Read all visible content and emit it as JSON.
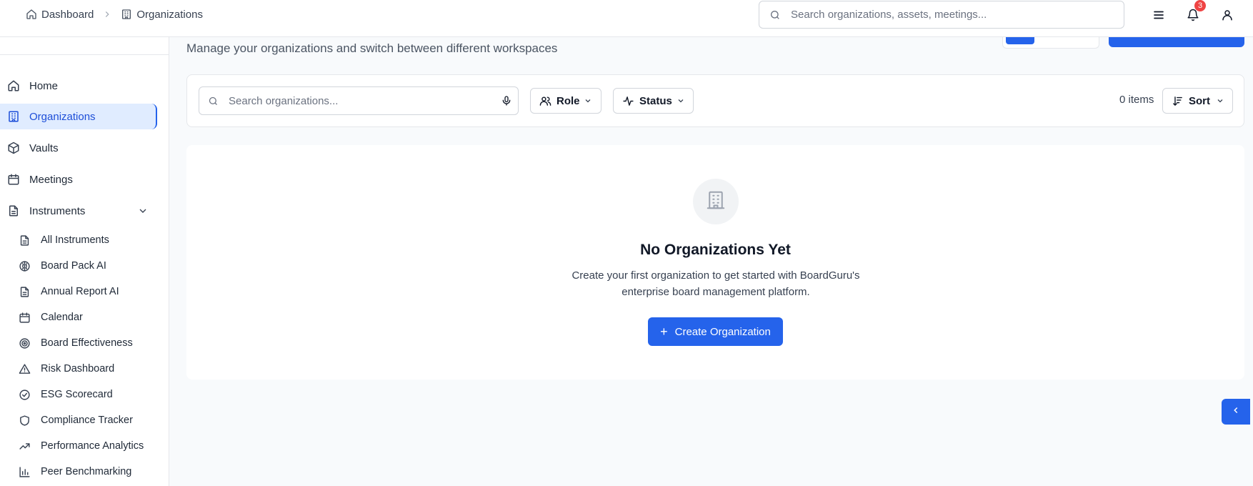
{
  "breadcrumb": {
    "home_label": "Dashboard",
    "current_label": "Organizations"
  },
  "header": {
    "search_placeholder": "Search organizations, assets, meetings...",
    "notification_count": "3"
  },
  "sidebar": {
    "items": [
      {
        "label": "Home",
        "icon": "home-icon"
      },
      {
        "label": "Organizations",
        "icon": "building-icon",
        "active": true
      },
      {
        "label": "Vaults",
        "icon": "box-icon"
      },
      {
        "label": "Meetings",
        "icon": "calendar-icon"
      },
      {
        "label": "Instruments",
        "icon": "document-icon",
        "expanded": true
      }
    ],
    "sub_items": [
      {
        "label": "All Instruments",
        "icon": "document-icon"
      },
      {
        "label": "Board Pack AI",
        "icon": "brain-icon"
      },
      {
        "label": "Annual Report AI",
        "icon": "document-icon"
      },
      {
        "label": "Calendar",
        "icon": "calendar-icon"
      },
      {
        "label": "Board Effectiveness",
        "icon": "target-icon"
      },
      {
        "label": "Risk Dashboard",
        "icon": "warning-icon"
      },
      {
        "label": "ESG Scorecard",
        "icon": "check-circle-icon"
      },
      {
        "label": "Compliance Tracker",
        "icon": "shield-icon"
      },
      {
        "label": "Performance Analytics",
        "icon": "trending-up-icon"
      },
      {
        "label": "Peer Benchmarking",
        "icon": "bar-chart-icon"
      }
    ]
  },
  "main": {
    "subtitle": "Manage your organizations and switch between different workspaces",
    "filters": {
      "search_placeholder": "Search organizations...",
      "role_label": "Role",
      "status_label": "Status",
      "items_count": "0 items",
      "sort_label": "Sort"
    },
    "empty_state": {
      "title": "No Organizations Yet",
      "description": "Create your first organization to get started with BoardGuru's enterprise board management platform.",
      "button_label": "Create Organization"
    }
  },
  "colors": {
    "accent": "#2563eb",
    "badge": "#ef4444",
    "active_bg": "#e0ecff"
  }
}
